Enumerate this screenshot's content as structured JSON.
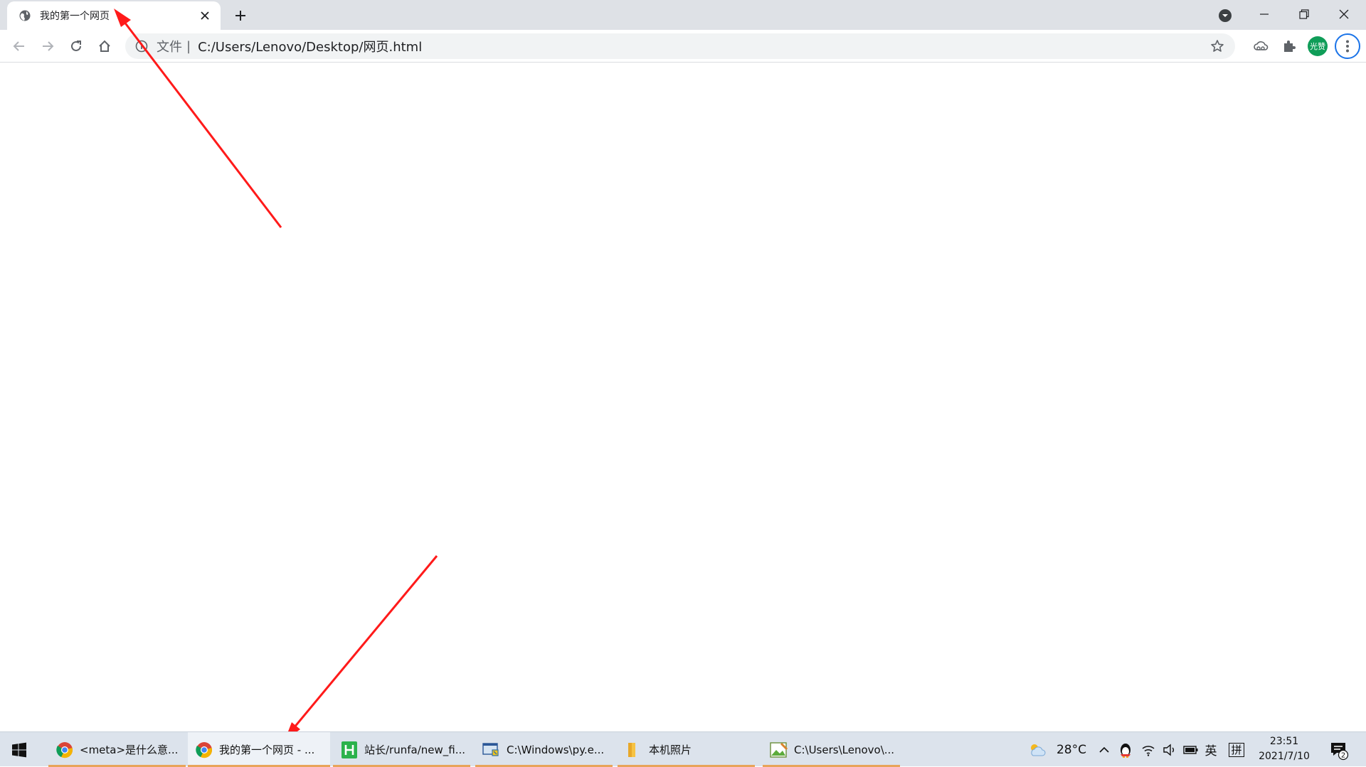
{
  "browser": {
    "tab": {
      "title": "我的第一个网页"
    },
    "toolbar": {
      "omnibox_label": "文件",
      "omnibox_separator": "|",
      "url": "C:/Users/Lenovo/Desktop/网页.html"
    },
    "profile": {
      "avatar_text": "光赞"
    }
  },
  "taskbar": {
    "items": [
      {
        "label": "<meta>是什么意...",
        "icon": "chrome-icon"
      },
      {
        "label": "我的第一个网页 - ...",
        "icon": "chrome-icon"
      },
      {
        "label": "站长/runfa/new_fi...",
        "icon": "hbuilder-icon"
      },
      {
        "label": "C:\\Windows\\py.e...",
        "icon": "python-launcher-icon"
      },
      {
        "label": "本机照片",
        "icon": "folder-icon"
      },
      {
        "label": "C:\\Users\\Lenovo\\...",
        "icon": "paint-icon"
      }
    ],
    "weather": {
      "temperature": "28°C"
    },
    "ime": {
      "language": "英",
      "mode": "拼"
    },
    "clock": {
      "time": "23:51",
      "date": "2021/7/10"
    },
    "notifications": {
      "count": "2"
    }
  },
  "colors": {
    "annotation_arrow": "#ff1a1a",
    "accent": "#1a73e8",
    "avatar": "#0f9d58",
    "taskbar_underline": "#e8a45a"
  }
}
